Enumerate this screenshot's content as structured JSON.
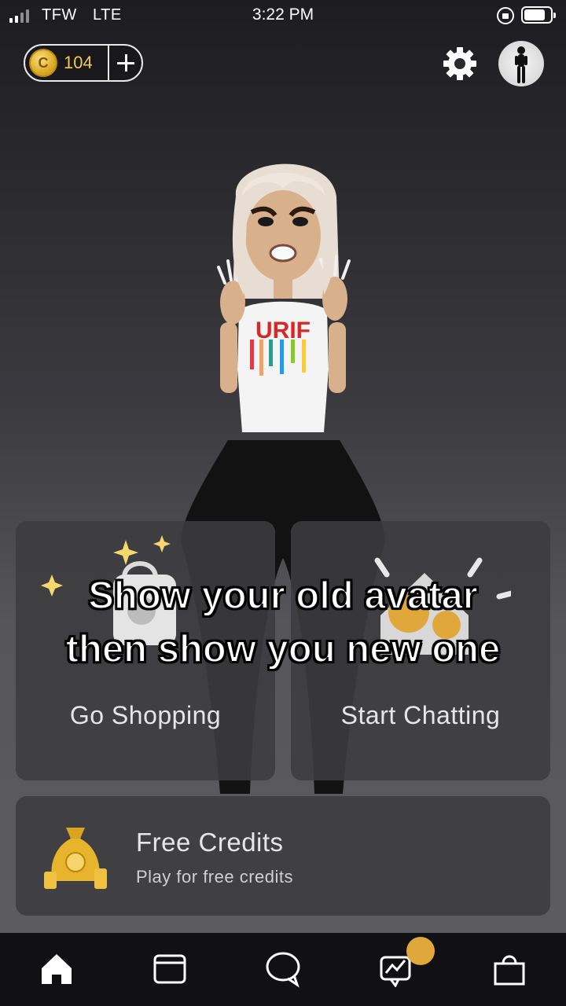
{
  "status_bar": {
    "carrier": "TFW",
    "network": "LTE",
    "time": "3:22 PM"
  },
  "header": {
    "credits": "104",
    "coin_symbol": "C"
  },
  "cards": {
    "shop_label": "Go Shopping",
    "chat_label": "Start Chatting",
    "free_credits_title": "Free Credits",
    "free_credits_subtitle": "Play for free credits"
  },
  "caption": {
    "line1": "Show your old avatar",
    "line2": "then show you new one"
  },
  "colors": {
    "coin_gold": "#f2c94c",
    "notification": "#e0a83a",
    "tab_bar": "#111113"
  },
  "icons": [
    "signal-icon",
    "rotation-lock-icon",
    "battery-icon",
    "coin-icon",
    "plus-icon",
    "gear-icon",
    "profile-avatar",
    "shopping-bag-icon",
    "house-chat-icon",
    "money-bag-icon",
    "home-icon",
    "feed-icon",
    "chat-bubble-icon",
    "activity-icon",
    "shop-bag-icon"
  ]
}
